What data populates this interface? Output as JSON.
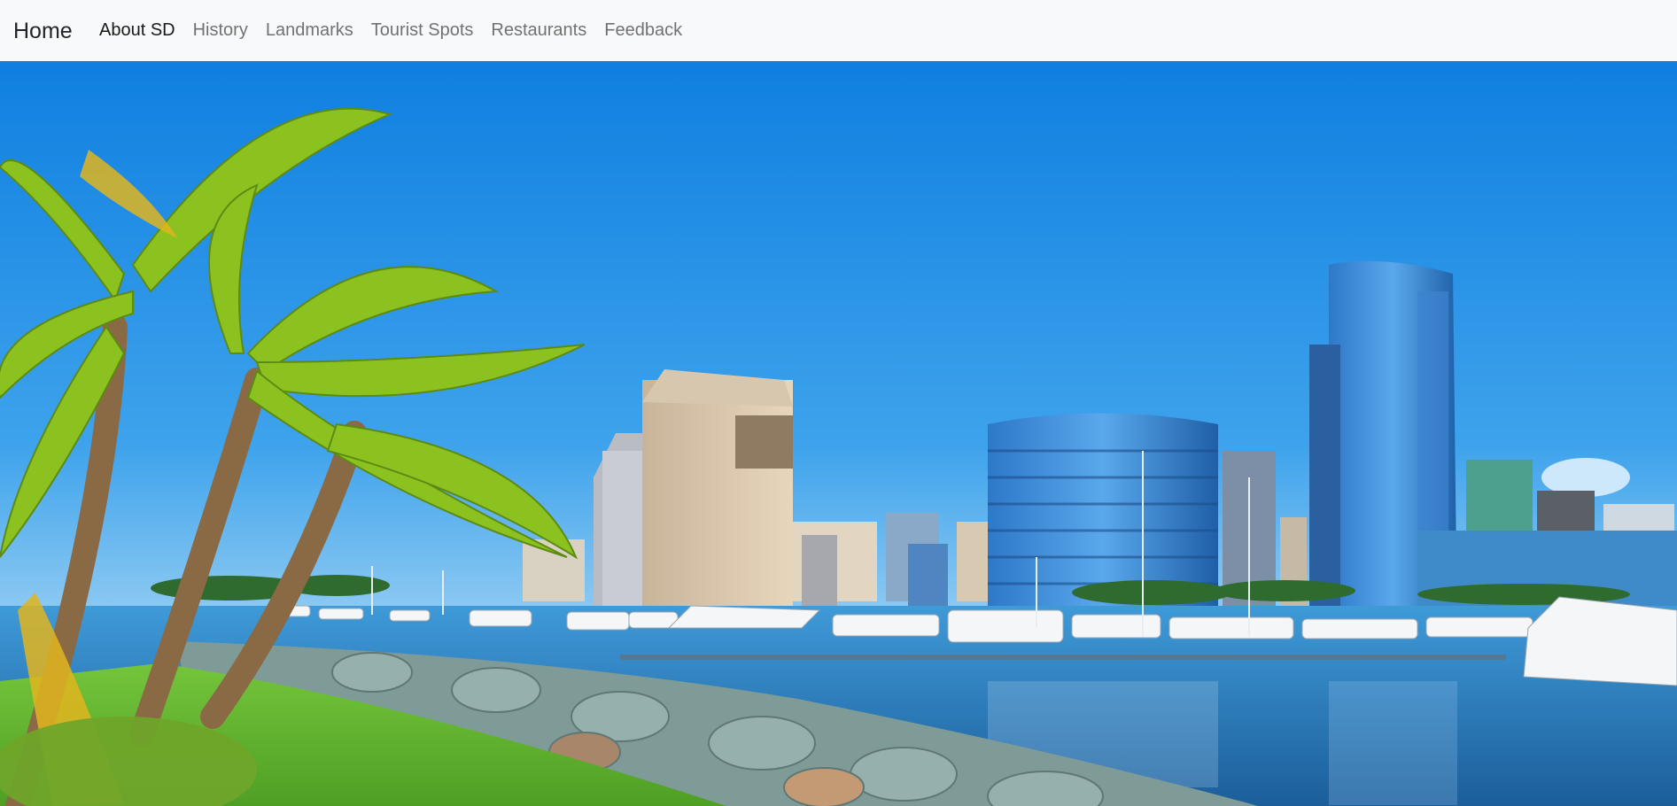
{
  "navbar": {
    "brand": "Home",
    "links": [
      {
        "label": "About SD",
        "active": true
      },
      {
        "label": "History",
        "active": false
      },
      {
        "label": "Landmarks",
        "active": false
      },
      {
        "label": "Tourist Spots",
        "active": false
      },
      {
        "label": "Restaurants",
        "active": false
      },
      {
        "label": "Feedback",
        "active": false
      }
    ]
  },
  "hero": {
    "image": "san-diego-waterfront-skyline-photo",
    "colors": {
      "sky": "#1f8fe6",
      "water": "#2a7fc6",
      "grass": "#5fb832",
      "palm": "#8cc21f",
      "rock": "#7f9b98"
    }
  }
}
